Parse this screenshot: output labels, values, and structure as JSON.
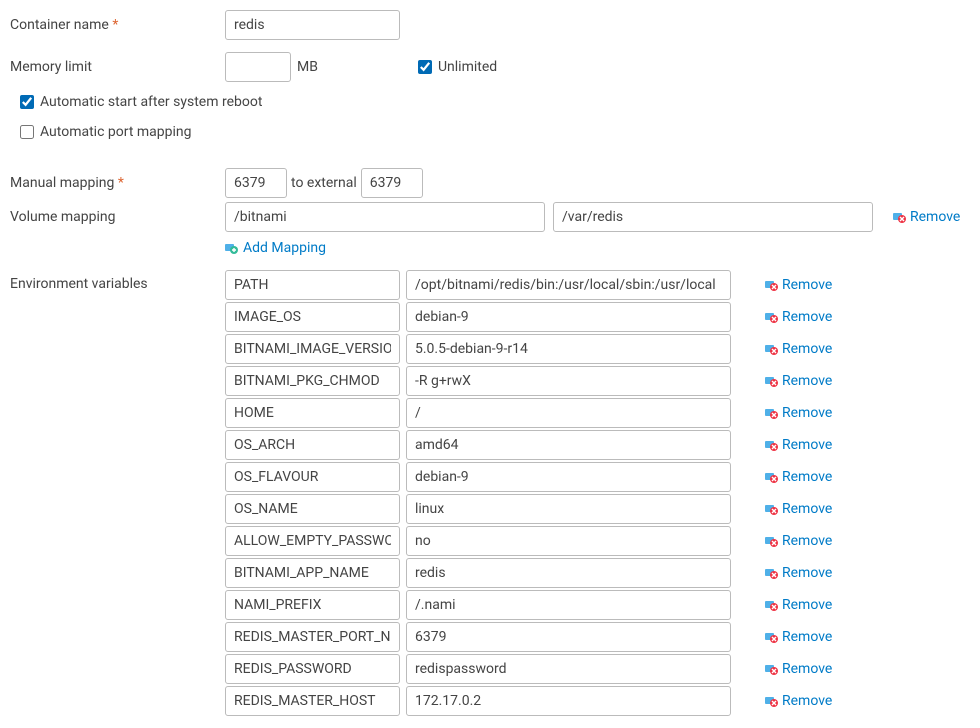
{
  "labels": {
    "container_name": "Container name",
    "memory_limit": "Memory limit",
    "mb": "MB",
    "unlimited": "Unlimited",
    "auto_start": "Automatic start after system reboot",
    "auto_port": "Automatic port mapping",
    "manual_mapping": "Manual mapping",
    "to_external": "to external",
    "volume_mapping": "Volume mapping",
    "add_mapping": "Add Mapping",
    "env_vars": "Environment variables",
    "remove": "Remove"
  },
  "fields": {
    "container_name": "redis",
    "memory_limit": "",
    "unlimited_checked": true,
    "auto_start_checked": true,
    "auto_port_checked": false,
    "port_internal": "6379",
    "port_external": "6379",
    "volume_a": "/bitnami",
    "volume_b": "/var/redis"
  },
  "env": [
    {
      "k": "PATH",
      "v": "/opt/bitnami/redis/bin:/usr/local/sbin:/usr/local"
    },
    {
      "k": "IMAGE_OS",
      "v": "debian-9"
    },
    {
      "k": "BITNAMI_IMAGE_VERSION",
      "v": "5.0.5-debian-9-r14"
    },
    {
      "k": "BITNAMI_PKG_CHMOD",
      "v": "-R g+rwX"
    },
    {
      "k": "HOME",
      "v": "/"
    },
    {
      "k": "OS_ARCH",
      "v": "amd64"
    },
    {
      "k": "OS_FLAVOUR",
      "v": "debian-9"
    },
    {
      "k": "OS_NAME",
      "v": "linux"
    },
    {
      "k": "ALLOW_EMPTY_PASSWORD",
      "v": "no"
    },
    {
      "k": "BITNAMI_APP_NAME",
      "v": "redis"
    },
    {
      "k": "NAMI_PREFIX",
      "v": "/.nami"
    },
    {
      "k": "REDIS_MASTER_PORT_NUMBER",
      "v": "6379"
    },
    {
      "k": "REDIS_PASSWORD",
      "v": "redispassword"
    },
    {
      "k": "REDIS_MASTER_HOST",
      "v": "172.17.0.2"
    }
  ]
}
